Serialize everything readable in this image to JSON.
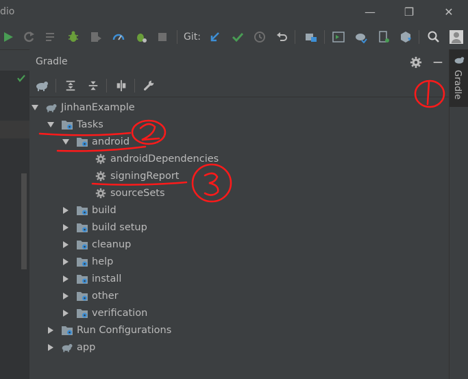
{
  "window": {
    "title_fragment": "dio"
  },
  "toolbar": {
    "git_label": "Git:"
  },
  "panel": {
    "title": "Gradle",
    "side_tab_label": "Gradle"
  },
  "tree": [
    {
      "label": "JinhanExample",
      "icon": "gradle-elephant-icon",
      "expanded": true
    },
    {
      "label": "Tasks",
      "icon": "folder-gear-icon",
      "expanded": true
    },
    {
      "label": "android",
      "icon": "folder-gear-icon",
      "expanded": true
    },
    {
      "label": "androidDependencies",
      "icon": "gear-icon"
    },
    {
      "label": "signingReport",
      "icon": "gear-icon"
    },
    {
      "label": "sourceSets",
      "icon": "gear-icon"
    },
    {
      "label": "build",
      "icon": "folder-gear-icon",
      "expanded": false
    },
    {
      "label": "build setup",
      "icon": "folder-gear-icon",
      "expanded": false
    },
    {
      "label": "cleanup",
      "icon": "folder-gear-icon",
      "expanded": false
    },
    {
      "label": "help",
      "icon": "folder-gear-icon",
      "expanded": false
    },
    {
      "label": "install",
      "icon": "folder-gear-icon",
      "expanded": false
    },
    {
      "label": "other",
      "icon": "folder-gear-icon",
      "expanded": false
    },
    {
      "label": "verification",
      "icon": "folder-gear-icon",
      "expanded": false
    },
    {
      "label": "Run Configurations",
      "icon": "folder-gear-icon",
      "expanded": false
    },
    {
      "label": "app",
      "icon": "gradle-elephant-icon",
      "expanded": false
    }
  ],
  "annotations": [
    "1",
    "2",
    "3"
  ],
  "colors": {
    "annotation": "#ff1a1a",
    "accent_blue": "#3d8fd6",
    "green": "#499c54"
  }
}
